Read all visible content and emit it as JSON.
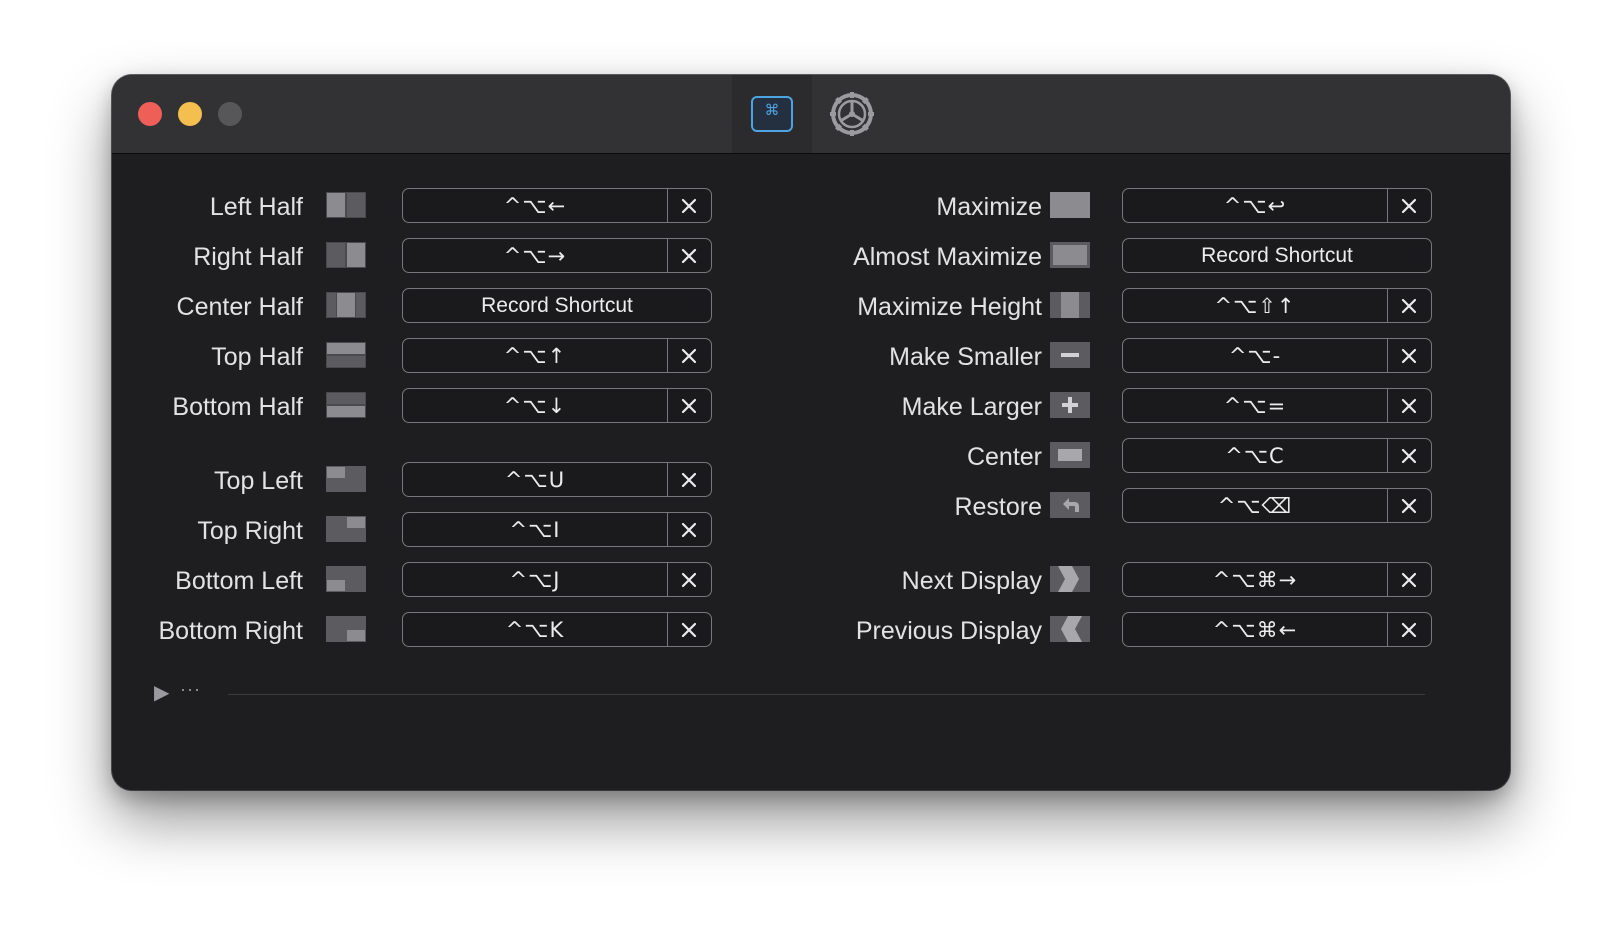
{
  "window": {
    "toolbar_tabs": [
      {
        "icon": "keyboard-shortcuts-icon",
        "glyph": "⌘",
        "active": true
      },
      {
        "icon": "gear-icon",
        "active": false
      }
    ]
  },
  "left_column": [
    {
      "label": "Left Half",
      "icon": "left-half-icon",
      "shortcut": "^⌥←",
      "clearable": true
    },
    {
      "label": "Right Half",
      "icon": "right-half-icon",
      "shortcut": "^⌥→",
      "clearable": true
    },
    {
      "label": "Center Half",
      "icon": "center-half-icon",
      "shortcut": "Record Shortcut",
      "clearable": false
    },
    {
      "label": "Top Half",
      "icon": "top-half-icon",
      "shortcut": "^⌥↑",
      "clearable": true
    },
    {
      "label": "Bottom Half",
      "icon": "bottom-half-icon",
      "shortcut": "^⌥↓",
      "clearable": true
    },
    {
      "label": "Top Left",
      "icon": "top-left-icon",
      "shortcut": "^⌥U",
      "clearable": true
    },
    {
      "label": "Top Right",
      "icon": "top-right-icon",
      "shortcut": "^⌥I",
      "clearable": true
    },
    {
      "label": "Bottom Left",
      "icon": "bottom-left-icon",
      "shortcut": "^⌥J",
      "clearable": true
    },
    {
      "label": "Bottom Right",
      "icon": "bottom-right-icon",
      "shortcut": "^⌥K",
      "clearable": true
    }
  ],
  "right_column": [
    {
      "label": "Maximize",
      "icon": "maximize-icon",
      "shortcut": "^⌥↩",
      "clearable": true
    },
    {
      "label": "Almost Maximize",
      "icon": "almost-maximize-icon",
      "shortcut": "Record Shortcut",
      "clearable": false
    },
    {
      "label": "Maximize Height",
      "icon": "maximize-height-icon",
      "shortcut": "^⌥⇧↑",
      "clearable": true
    },
    {
      "label": "Make Smaller",
      "icon": "make-smaller-icon",
      "shortcut": "^⌥-",
      "clearable": true
    },
    {
      "label": "Make Larger",
      "icon": "make-larger-icon",
      "shortcut": "^⌥=",
      "clearable": true
    },
    {
      "label": "Center",
      "icon": "center-icon",
      "shortcut": "^⌥C",
      "clearable": true
    },
    {
      "label": "Restore",
      "icon": "restore-icon",
      "shortcut": "^⌥⌫",
      "clearable": true
    },
    {
      "label": "Next Display",
      "icon": "next-display-icon",
      "shortcut": "^⌥⌘→",
      "clearable": true
    },
    {
      "label": "Previous Display",
      "icon": "previous-display-icon",
      "shortcut": "^⌥⌘←",
      "clearable": true
    }
  ],
  "footer": {
    "play_glyph": "▶",
    "more_glyph": "···"
  },
  "colors": {
    "window_bg": "#1e1e20",
    "titlebar_bg": "#323235",
    "close": "#ed5f57",
    "minimize": "#f4bf4f",
    "zoom_disabled": "#57575a",
    "accent": "#4fa3df",
    "icon_dark": "#4a4a4d",
    "icon_light": "#8c8c90"
  }
}
